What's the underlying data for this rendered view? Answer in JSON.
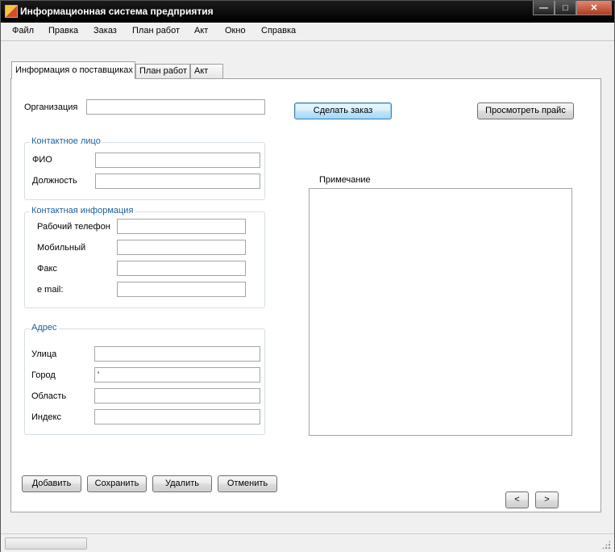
{
  "window": {
    "title": "Информационная система предприятия",
    "controls": {
      "minimize": "—",
      "maximize": "□",
      "close": "✕"
    }
  },
  "menu": [
    "Файл",
    "Правка",
    "Заказ",
    "План работ",
    "Акт",
    "Окно",
    "Справка"
  ],
  "tabs": [
    {
      "label": "Информация о поставщиках",
      "active": true
    },
    {
      "label": "План работ",
      "active": false
    },
    {
      "label": "Акт",
      "active": false
    }
  ],
  "form": {
    "organization_label": "Организация",
    "contact_person": {
      "caption": "Контактное лицо",
      "fio_label": "ФИО",
      "position_label": "Должность"
    },
    "contact_info": {
      "caption": "Контактная информация",
      "work_phone_label": "Рабочий телефон",
      "mobile_label": "Мобильный",
      "fax_label": "Факс",
      "email_label": "e mail:"
    },
    "address": {
      "caption": "Адрес",
      "street_label": "Улица",
      "city_label": "Город",
      "city_value": "'",
      "region_label": "Область",
      "index_label": "Индекс"
    },
    "note_label": "Примечание"
  },
  "buttons": {
    "make_order": "Сделать заказ",
    "view_price": "Просмотреть прайс",
    "add": "Добавить",
    "save": "Сохранить",
    "delete": "Удалить",
    "cancel": "Отменить",
    "prev": "<",
    "next": ">"
  }
}
